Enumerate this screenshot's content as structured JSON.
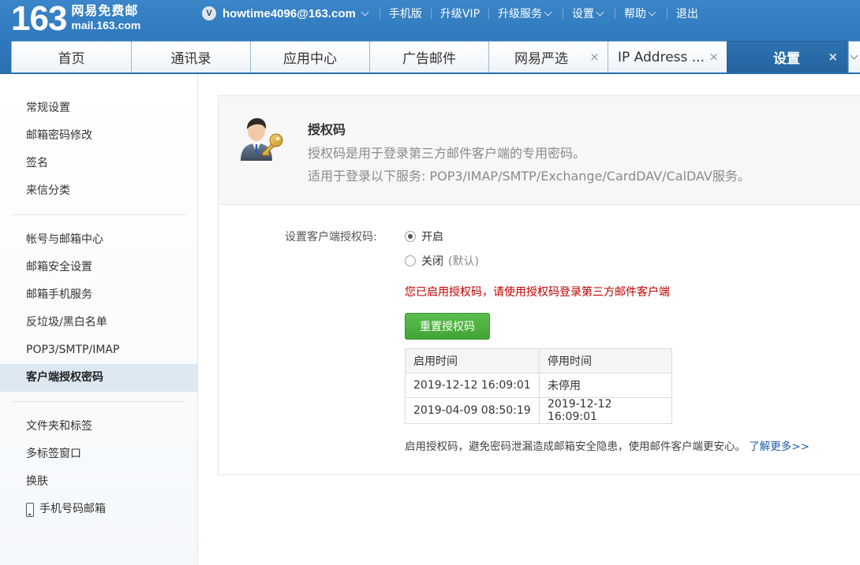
{
  "header": {
    "logo_number": "163",
    "logo_name": "网易免费邮",
    "logo_domain": "mail.163.com",
    "vip_badge": "V",
    "account": "howtime4096@163.com",
    "links": [
      {
        "label": "手机版",
        "dropdown": false
      },
      {
        "label": "升级VIP",
        "dropdown": false
      },
      {
        "label": "升级服务",
        "dropdown": true
      },
      {
        "label": "设置",
        "dropdown": true
      },
      {
        "label": "帮助",
        "dropdown": true
      },
      {
        "label": "退出",
        "dropdown": false
      }
    ]
  },
  "tabs": [
    {
      "label": "首页",
      "closable": false,
      "active": false
    },
    {
      "label": "通讯录",
      "closable": false,
      "active": false
    },
    {
      "label": "应用中心",
      "closable": false,
      "active": false
    },
    {
      "label": "广告邮件",
      "closable": false,
      "active": false
    },
    {
      "label": "网易严选",
      "closable": true,
      "active": false
    },
    {
      "label": "IP Address ...",
      "closable": true,
      "active": false
    },
    {
      "label": "设置",
      "closable": true,
      "active": true
    }
  ],
  "tab_close_glyph": "×",
  "sidebar": {
    "groups": [
      {
        "items": [
          {
            "label": "常规设置"
          },
          {
            "label": "邮箱密码修改"
          },
          {
            "label": "签名"
          },
          {
            "label": "来信分类"
          }
        ]
      },
      {
        "items": [
          {
            "label": "帐号与邮箱中心"
          },
          {
            "label": "邮箱安全设置"
          },
          {
            "label": "邮箱手机服务"
          },
          {
            "label": "反垃圾/黑白名单"
          },
          {
            "label": "POP3/SMTP/IMAP"
          },
          {
            "label": "客户端授权密码",
            "active": true
          }
        ]
      },
      {
        "items": [
          {
            "label": "文件夹和标签"
          },
          {
            "label": "多标签窗口"
          },
          {
            "label": "换肤"
          },
          {
            "label": "手机号码邮箱",
            "icon": "phone-icon"
          }
        ]
      }
    ]
  },
  "main": {
    "title": "授权码",
    "desc_line1": "授权码是用于登录第三方邮件客户端的专用密码。",
    "desc_line2": "适用于登录以下服务: POP3/IMAP/SMTP/Exchange/CardDAV/CalDAV服务。",
    "setting_label": "设置客户端授权码:",
    "option_on": "开启",
    "option_off": "关闭",
    "option_off_hint": "(默认)",
    "selected": "on",
    "notice": "您已启用授权码，请使用授权码登录第三方邮件客户端",
    "reset_button": "重置授权码",
    "table": {
      "headers": [
        "启用时间",
        "停用时间"
      ],
      "rows": [
        [
          "2019-12-12 16:09:01",
          "未停用"
        ],
        [
          "2019-04-09 08:50:19",
          "2019-12-12 16:09:01"
        ]
      ]
    },
    "footer_text": "启用授权码，避免密码泄漏造成邮箱安全隐患，使用邮件客户端更安心。",
    "footer_link": "了解更多>>"
  },
  "colors": {
    "header_blue": "#2f78bd",
    "active_tab": "#2a6aa8",
    "notice_red": "#c00000",
    "button_green": "#4caf3f",
    "link_blue": "#1f5aa6"
  }
}
